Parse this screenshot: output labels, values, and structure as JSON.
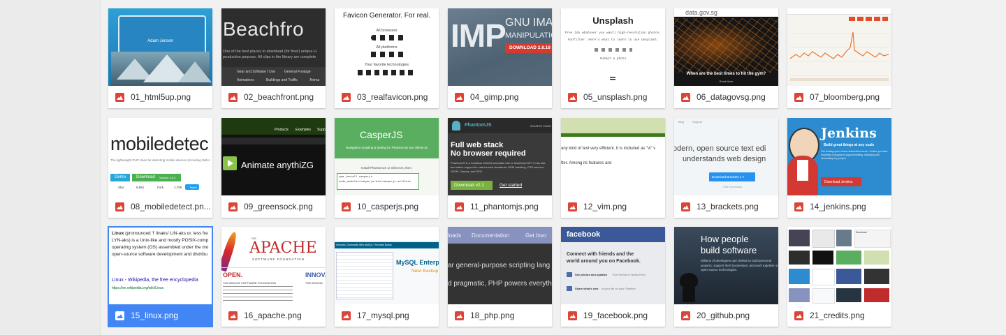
{
  "files": [
    {
      "name": "01_html5up.png"
    },
    {
      "name": "02_beachfront.png"
    },
    {
      "name": "03_realfavicon.png"
    },
    {
      "name": "04_gimp.png"
    },
    {
      "name": "05_unsplash.png"
    },
    {
      "name": "06_datagovsg.png"
    },
    {
      "name": "07_bloomberg.png"
    },
    {
      "name": "08_mobiledetect.pn..."
    },
    {
      "name": "09_greensock.png"
    },
    {
      "name": "10_casperjs.png"
    },
    {
      "name": "11_phantomjs.png"
    },
    {
      "name": "12_vim.png"
    },
    {
      "name": "13_brackets.png"
    },
    {
      "name": "14_jenkins.png"
    },
    {
      "name": "15_linux.png"
    },
    {
      "name": "16_apache.png"
    },
    {
      "name": "17_mysql.png"
    },
    {
      "name": "18_php.png"
    },
    {
      "name": "19_facebook.png"
    },
    {
      "name": "20_github.png"
    },
    {
      "name": "21_credits.png"
    }
  ],
  "selected_index": 14,
  "thumbs": {
    "html5up": {
      "name": "Adam Jensen"
    },
    "beachfront": {
      "title": "Beachfro",
      "desc": "One of the best places to download (for free!) unique H production purpose. All clips in the library are complete",
      "nav1": "Gear and Software I Use",
      "nav2": "General Footage",
      "nav3": "Animations",
      "nav4": "Buildings and Traffic",
      "nav5": "Anima"
    },
    "realfavicon": {
      "title": "Favicon Generator. For real.",
      "l1": "All browsers",
      "l2": "All platforms",
      "l3": "Your favorite technologies"
    },
    "gimp": {
      "big": "IMP",
      "side1": "GNU IMAG",
      "side2": "MANIPULATION",
      "btn": "DOWNLOAD 2.8.18"
    },
    "unsplash": {
      "title": "Unsplash",
      "line1": "Free (do whatever you want) high-resolution photos.",
      "line2": "#unfilter: Here's what to learn to use Unsplash.",
      "link": "Submit a photo"
    },
    "datagovsg": {
      "brand": "data.gov.sg",
      "caption": "When are the best times to hit the gym?",
      "more": "Read More"
    },
    "mobiledetect": {
      "title": "mobiledetec",
      "desc": "The lightweight PHP class for detecting mobile devices (including tablet",
      "b1": "Demo",
      "b2": "Download",
      "ver": "Version 2.8.2",
      "star": "Star",
      "stars": "6,881",
      "fork": "Fork",
      "forks": "1,756",
      "tweet": "Tweet"
    },
    "greensock": {
      "t1": "Products",
      "t2": "Examples",
      "t3": "Supp",
      "text": "Animate anythiZG"
    },
    "casperjs": {
      "title": "CasperJS",
      "sub": "Navigation scripting & testing for PhantomJS and SlimerJS",
      "install": "Install PhantomJS or SlimerJS, then:",
      "c1": "npm install casperjs",
      "c2": "node_modules/casperjs/bin/casperjs selftest"
    },
    "phantomjs": {
      "brand": "PhantomJS",
      "src": "SOURCE CODE",
      "h1": "Full web stack",
      "h2": "No browser required",
      "desc": "PhantomJS is a headless WebKit scriptable with a JavaScript API. It has fast and native support for various web standards: DOM handling, CSS selector, JSON, Canvas, and SVG.",
      "dl": "Download v2.1",
      "start": "Get started"
    },
    "vim": {
      "l1": "any kind of text very efficient. It is included as \"vi\" v",
      "l2": "tter. Among its features are:"
    },
    "brackets": {
      "n1": "Blog",
      "n2": "Support",
      "h1": "odern, open source text edi",
      "h2": "understands web design",
      "btn": "Download Brackets 1.7",
      "other": "Other Downloads"
    },
    "jenkins": {
      "title": "Jenkins",
      "tag": "Build great things at any scale",
      "desc": "The leading open source automation server, Jenkins provides hundreds of plugins to support building, deploying and automating any project.",
      "btn": "Download Jenkins"
    },
    "linux": {
      "p1": "Linux",
      "p2": "(pronounced 'l' linaks/ LIN-aks or, less fre",
      "p3": "LYN-aks) is a Unix-like and mostly POSIX-comp",
      "p4": "operating system (OS) assembled under the mo",
      "p5": "open-source software development and distribu",
      "link": "Linux - Wikipedia, the free encyclopedia",
      "url": "https://en.wikipedia.org/wiki/Linux"
    },
    "apache": {
      "the": "THE",
      "name": "APACHE",
      "sub": "SOFTWARE FOUNDATION",
      "h1": "OPEN.",
      "h2": "INNOVA",
      "t1": "THE APACHE SOFTWARE FOUNDATION",
      "t2": "THE APACHE"
    },
    "mysql": {
      "tabs": "Services  Community  Why MySQL?  Services  Books",
      "title": "MySQL Enterpri",
      "sub": "New! Backup"
    },
    "php": {
      "n1": "loads",
      "n2": "Documentation",
      "n3": "Get Invo",
      "l1": "ar general-purpose scripting lang",
      "l2": "d pragmatic, PHP powers everyth"
    },
    "facebook": {
      "brand": "facebook",
      "h1": "Connect with friends and the",
      "h2": "world around you on Facebook.",
      "i1": "See photos and updates",
      "i1b": "from friends in News Feed.",
      "i2": "Share what's new",
      "i2b": "in your life on your Timeline."
    },
    "github": {
      "h1": "How people",
      "h2": "build software",
      "desc": "Millions of developers use GitHub to build personal projects, support their businesses, and work together on open source technologies."
    },
    "credits": {
      "label": "Download"
    }
  }
}
